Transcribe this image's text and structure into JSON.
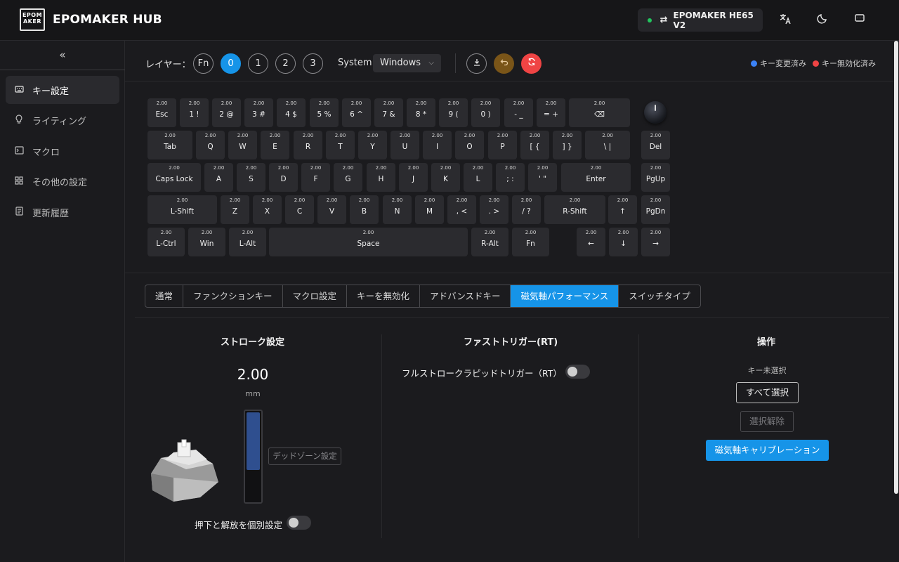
{
  "app": {
    "logo_lines": [
      "EPOM",
      "AKER"
    ],
    "title": "EPOMAKER HUB"
  },
  "header": {
    "device_name": "EPOMAKER HE65 V2",
    "device_status_color": "#22c55e",
    "icons": [
      "translate-icon",
      "moon-icon",
      "message-icon"
    ]
  },
  "sidebar": {
    "collapse_glyph": "«",
    "items": [
      {
        "label": "キー設定",
        "icon": "keyboard-icon",
        "active": true
      },
      {
        "label": "ライティング",
        "icon": "bulb-icon",
        "active": false
      },
      {
        "label": "マクロ",
        "icon": "terminal-icon",
        "active": false
      },
      {
        "label": "その他の設定",
        "icon": "grid-icon",
        "active": false
      },
      {
        "label": "更新履歴",
        "icon": "document-icon",
        "active": false
      }
    ]
  },
  "toolbar": {
    "layer_label": "レイヤー：",
    "layers": [
      "Fn",
      "0",
      "1",
      "2",
      "3"
    ],
    "active_layer": "0",
    "system_label": "System",
    "os_selected": "Windows",
    "legend": [
      {
        "label": "キー変更済み",
        "color": "#3b82f6"
      },
      {
        "label": "キー無効化済み",
        "color": "#ef4444"
      }
    ]
  },
  "keyboard": {
    "rows": [
      [
        {
          "v": "2.00",
          "l": "Esc"
        },
        {
          "v": "2.00",
          "l": "1 !"
        },
        {
          "v": "2.00",
          "l": "2 @"
        },
        {
          "v": "2.00",
          "l": "3 #"
        },
        {
          "v": "2.00",
          "l": "4 $"
        },
        {
          "v": "2.00",
          "l": "5 %"
        },
        {
          "v": "2.00",
          "l": "6 ^"
        },
        {
          "v": "2.00",
          "l": "7 &"
        },
        {
          "v": "2.00",
          "l": "8 *"
        },
        {
          "v": "2.00",
          "l": "9 ("
        },
        {
          "v": "2.00",
          "l": "0 )"
        },
        {
          "v": "2.00",
          "l": "- _"
        },
        {
          "v": "2.00",
          "l": "= +"
        },
        {
          "v": "2.00",
          "l": "⌫"
        }
      ],
      [
        {
          "v": "2.00",
          "l": "Tab"
        },
        {
          "v": "2.00",
          "l": "Q"
        },
        {
          "v": "2.00",
          "l": "W"
        },
        {
          "v": "2.00",
          "l": "E"
        },
        {
          "v": "2.00",
          "l": "R"
        },
        {
          "v": "2.00",
          "l": "T"
        },
        {
          "v": "2.00",
          "l": "Y"
        },
        {
          "v": "2.00",
          "l": "U"
        },
        {
          "v": "2.00",
          "l": "I"
        },
        {
          "v": "2.00",
          "l": "O"
        },
        {
          "v": "2.00",
          "l": "P"
        },
        {
          "v": "2.00",
          "l": "[ {"
        },
        {
          "v": "2.00",
          "l": "] }"
        },
        {
          "v": "2.00",
          "l": "\\ |"
        },
        {
          "v": "2.00",
          "l": "Del"
        }
      ],
      [
        {
          "v": "2.00",
          "l": "Caps Lock"
        },
        {
          "v": "2.00",
          "l": "A"
        },
        {
          "v": "2.00",
          "l": "S"
        },
        {
          "v": "2.00",
          "l": "D"
        },
        {
          "v": "2.00",
          "l": "F"
        },
        {
          "v": "2.00",
          "l": "G"
        },
        {
          "v": "2.00",
          "l": "H"
        },
        {
          "v": "2.00",
          "l": "J"
        },
        {
          "v": "2.00",
          "l": "K"
        },
        {
          "v": "2.00",
          "l": "L"
        },
        {
          "v": "2.00",
          "l": "; :"
        },
        {
          "v": "2.00",
          "l": "' \""
        },
        {
          "v": "2.00",
          "l": "Enter"
        },
        {
          "v": "2.00",
          "l": "PgUp"
        }
      ],
      [
        {
          "v": "2.00",
          "l": "L-Shift"
        },
        {
          "v": "2.00",
          "l": "Z"
        },
        {
          "v": "2.00",
          "l": "X"
        },
        {
          "v": "2.00",
          "l": "C"
        },
        {
          "v": "2.00",
          "l": "V"
        },
        {
          "v": "2.00",
          "l": "B"
        },
        {
          "v": "2.00",
          "l": "N"
        },
        {
          "v": "2.00",
          "l": "M"
        },
        {
          "v": "2.00",
          "l": ", <"
        },
        {
          "v": "2.00",
          "l": ". >"
        },
        {
          "v": "2.00",
          "l": "/ ?"
        },
        {
          "v": "2.00",
          "l": "R-Shift"
        },
        {
          "v": "2.00",
          "l": "↑"
        },
        {
          "v": "2.00",
          "l": "PgDn"
        }
      ],
      [
        {
          "v": "2.00",
          "l": "L-Ctrl"
        },
        {
          "v": "2.00",
          "l": "Win"
        },
        {
          "v": "2.00",
          "l": "L-Alt"
        },
        {
          "v": "2.00",
          "l": "Space"
        },
        {
          "v": "2.00",
          "l": "R-Alt"
        },
        {
          "v": "2.00",
          "l": "Fn"
        },
        {
          "v": "2.00",
          "l": "←"
        },
        {
          "v": "2.00",
          "l": "↓"
        },
        {
          "v": "2.00",
          "l": "→"
        }
      ]
    ]
  },
  "tabs": [
    {
      "label": "通常",
      "active": false
    },
    {
      "label": "ファンクションキー",
      "active": false
    },
    {
      "label": "マクロ設定",
      "active": false
    },
    {
      "label": "キーを無効化",
      "active": false
    },
    {
      "label": "アドバンスドキー",
      "active": false
    },
    {
      "label": "磁気軸パフォーマンス",
      "active": true
    },
    {
      "label": "スイッチタイプ",
      "active": false
    }
  ],
  "stroke": {
    "title": "ストローク設定",
    "value": "2.00",
    "unit": "mm",
    "level": 0.65,
    "deadzone_label": "デッドゾーン設定",
    "separate_label": "押下と解放を個別設定",
    "separate_enabled": false
  },
  "rt": {
    "title": "ファストトリガー(RT)",
    "full_stroke_label": "フルストロークラピッドトリガー（RT）",
    "full_stroke_enabled": false
  },
  "operation": {
    "title": "操作",
    "no_key_text": "キー未選択",
    "select_all": "すべて選択",
    "deselect": "選択解除",
    "calibrate": "磁気軸キャリブレーション"
  },
  "colors": {
    "accent": "#1694e8",
    "undo": "#7a5518",
    "reset": "#ef4444"
  }
}
